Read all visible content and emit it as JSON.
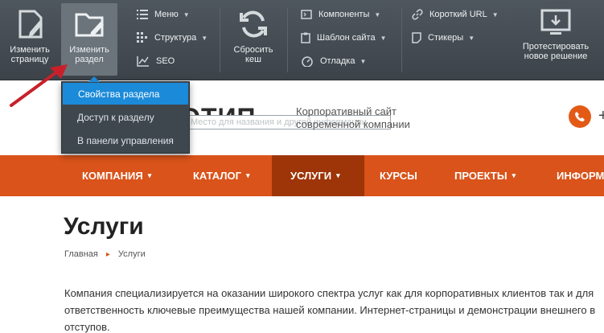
{
  "admin": {
    "change_page": "Изменить страницу",
    "change_section": "Изменить раздел",
    "menu": "Меню",
    "structure": "Структура",
    "seo": "SEO",
    "reset_cache": "Сбросить кеш",
    "components": "Компоненты",
    "site_template": "Шаблон сайта",
    "debug": "Отладка",
    "short_url": "Короткий URL",
    "stickers": "Стикеры",
    "test_solution": "Протестировать новое решение"
  },
  "dropdown": {
    "items": [
      "Свойства раздела",
      "Доступ к разделу",
      "В панели управления"
    ]
  },
  "site": {
    "logo": "ЛОГОТИП",
    "slogan_placeholder": "Место для названия и другой информации",
    "desc_line1": "Корпоративный сайт",
    "desc_line2": "современной компании",
    "plus": "+"
  },
  "nav": {
    "items": [
      "КОМПАНИЯ",
      "КАТАЛОГ",
      "УСЛУГИ",
      "КУРСЫ",
      "ПРОЕКТЫ",
      "ИНФОРМ"
    ]
  },
  "page": {
    "title": "Услуги",
    "breadcrumb_home": "Главная",
    "breadcrumb_current": "Услуги",
    "text_line1": "Компания специализируется на оказании широкого спектра услуг как для корпоративных клиентов так и для",
    "text_line2": "ответственность ключевые преимущества нашей компании. Интернет-страницы и демонстрации внешнего в",
    "text_line3": "отступов."
  },
  "colors": {
    "accent": "#d9531a",
    "accent_dark": "#9e3508",
    "panel": "#434a50",
    "highlight": "#1b8ad9"
  }
}
